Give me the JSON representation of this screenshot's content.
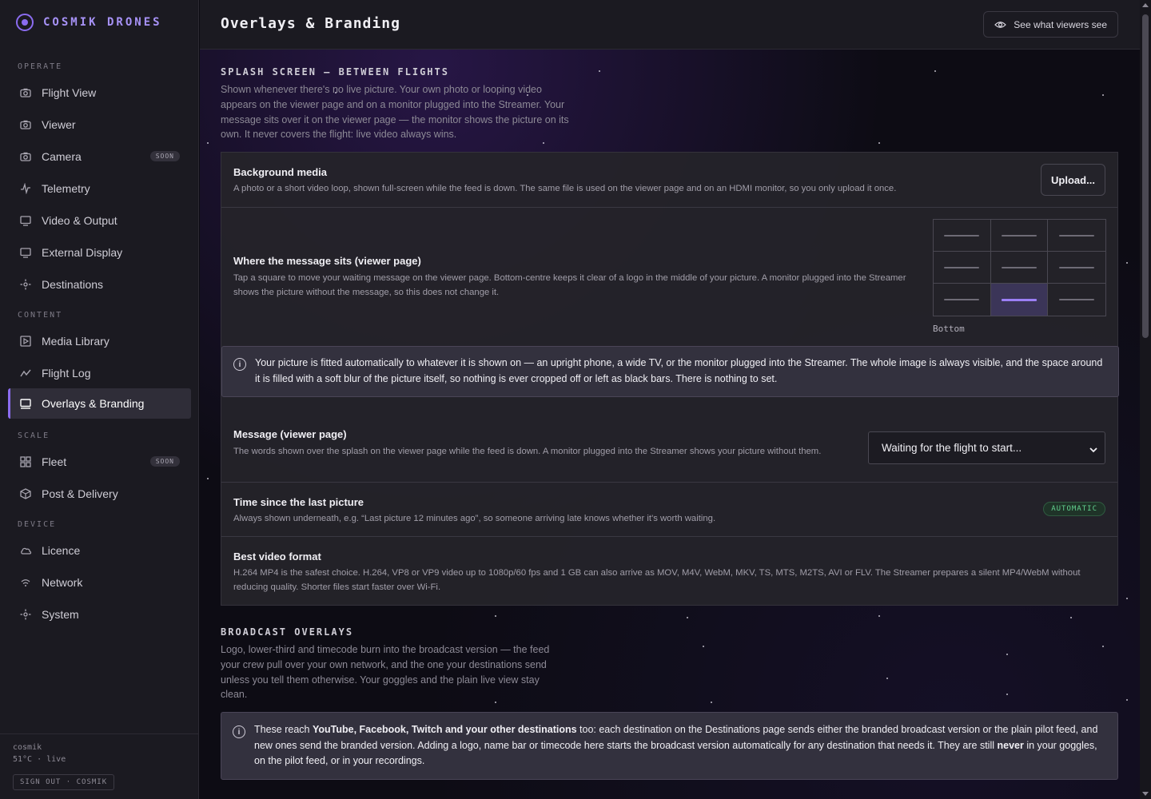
{
  "brand": {
    "name": "COSMIK DRONES"
  },
  "sidebar": {
    "sections": [
      {
        "label": "OPERATE"
      },
      {
        "label": "CONTENT"
      },
      {
        "label": "SCALE"
      },
      {
        "label": "DEVICE"
      }
    ],
    "items": [
      {
        "label": "Flight View",
        "icon": "camera-icon"
      },
      {
        "label": "Viewer",
        "icon": "camera-icon"
      },
      {
        "label": "Camera",
        "icon": "camera-icon",
        "badge": "SOON"
      },
      {
        "label": "Telemetry",
        "icon": "activity-icon"
      },
      {
        "label": "Video & Output",
        "icon": "monitor-icon"
      },
      {
        "label": "External Display",
        "icon": "monitor-icon"
      },
      {
        "label": "Destinations",
        "icon": "crosshair-icon"
      },
      {
        "label": "Media Library",
        "icon": "play-square-icon"
      },
      {
        "label": "Flight Log",
        "icon": "chart-line-icon"
      },
      {
        "label": "Overlays & Branding",
        "icon": "screen-icon",
        "active": true
      },
      {
        "label": "Fleet",
        "icon": "grid-icon",
        "badge": "SOON"
      },
      {
        "label": "Post & Delivery",
        "icon": "box-icon"
      },
      {
        "label": "Licence",
        "icon": "cloud-icon"
      },
      {
        "label": "Network",
        "icon": "wifi-icon"
      },
      {
        "label": "System",
        "icon": "gear-icon"
      }
    ],
    "footer": {
      "user": "cosmik",
      "status": "51°C · live",
      "signout": "SIGN OUT · COSMIK"
    }
  },
  "header": {
    "title": "Overlays & Branding",
    "viewers_button": "See what viewers see",
    "viewers_icon": "eye-icon"
  },
  "splash": {
    "title": "SPLASH SCREEN — BETWEEN FLIGHTS",
    "description": "Shown whenever there's no live picture. Your own photo or looping video appears on the viewer page and on a monitor plugged into the Streamer. Your message sits over it on the viewer page — the monitor shows the picture on its own. It never covers the flight: live video always wins.",
    "background_media": {
      "title": "Background media",
      "description": "A photo or a short video loop, shown full-screen while the feed is down. The same file is used on the viewer page and on an HDMI monitor, so you only upload it once.",
      "button": "Upload..."
    },
    "message_position": {
      "title": "Where the message sits (viewer page)",
      "description": "Tap a square to move your waiting message on the viewer page. Bottom-centre keeps it clear of a logo in the middle of your picture. A monitor plugged into the Streamer shows the picture without the message, so this does not change it.",
      "selected_label": "Bottom",
      "selected_index": 7
    },
    "info": "Your picture is fitted automatically to whatever it is shown on — an upright phone, a wide TV, or the monitor plugged into the Streamer. The whole image is always visible, and the space around it is filled with a soft blur of the picture itself, so nothing is ever cropped off or left as black bars. There is nothing to set.",
    "message": {
      "title": "Message (viewer page)",
      "description": "The words shown over the splash on the viewer page while the feed is down. A monitor plugged into the Streamer shows your picture without them.",
      "selected": "Waiting for the flight to start..."
    },
    "time_since": {
      "title": "Time since the last picture",
      "description": "Always shown underneath, e.g. “Last picture 12 minutes ago”, so someone arriving late knows whether it's worth waiting.",
      "badge": "AUTOMATIC"
    },
    "video_format": {
      "title": "Best video format",
      "description": "H.264 MP4 is the safest choice. H.264, VP8 or VP9 video up to 1080p/60 fps and 1 GB can also arrive as MOV, M4V, WebM, MKV, TS, MTS, M2TS, AVI or FLV. The Streamer prepares a silent MP4/WebM without reducing quality. Shorter files start faster over Wi-Fi."
    }
  },
  "broadcast": {
    "title": "BROADCAST OVERLAYS",
    "description": "Logo, lower-third and timecode burn into the broadcast version — the feed your crew pull over your own network, and the one your destinations send unless you tell them otherwise. Your goggles and the plain live view stay clean.",
    "info": {
      "prefix": "These reach ",
      "bold1": "YouTube, Facebook, Twitch and your other destinations",
      "middle": " too: each destination on the Destinations page sends either the branded broadcast version or the plain pilot feed, and new ones send the branded version. Adding a logo, name bar or timecode here starts the broadcast version automatically for any destination that needs it. They are still ",
      "bold2": "never",
      "suffix": " in your goggles, on the pilot feed, or in your recordings."
    }
  },
  "colors": {
    "accent": "#8b6cf0",
    "success": "#63d18f"
  }
}
